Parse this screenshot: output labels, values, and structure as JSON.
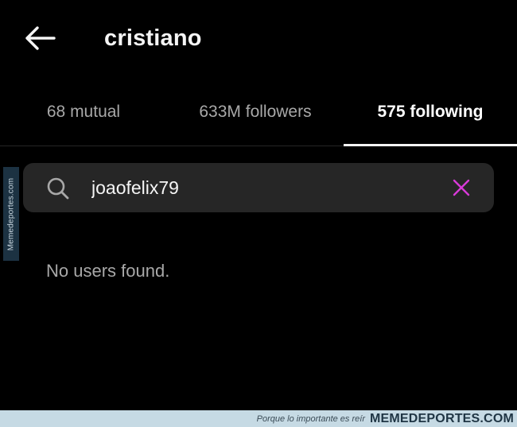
{
  "header": {
    "back_icon": "arrow-left-icon",
    "title": "cristiano"
  },
  "tabs": [
    {
      "label": "68 mutual",
      "active": false
    },
    {
      "label": "633M followers",
      "active": false
    },
    {
      "label": "575 following",
      "active": true
    }
  ],
  "search": {
    "icon": "search-icon",
    "value": "joaofelix79",
    "clear_icon": "close-icon",
    "clear_color": "#d83ad8"
  },
  "results": {
    "empty_message": "No users found."
  },
  "watermark": {
    "side_text": "Memedeportes.com",
    "footer_tagline": "Porque lo importante es reír",
    "footer_brand": "MEMEDEPORTES.COM"
  }
}
